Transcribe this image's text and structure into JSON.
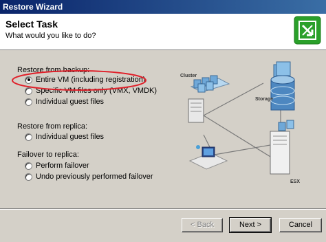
{
  "window": {
    "title": "Restore Wizard"
  },
  "header": {
    "title": "Select Task",
    "subtitle": "What would you like to do?"
  },
  "sections": {
    "backup": {
      "label": "Restore from backup:",
      "options": [
        {
          "label": "Entire VM (including registration)",
          "checked": true
        },
        {
          "label": "Specific VM files only (VMX, VMDK)",
          "checked": false
        },
        {
          "label": "Individual guest files",
          "checked": false
        }
      ]
    },
    "replica": {
      "label": "Restore from replica:",
      "options": [
        {
          "label": "Individual guest files",
          "checked": false
        }
      ]
    },
    "failover": {
      "label": "Failover to replica:",
      "options": [
        {
          "label": "Perform failover",
          "checked": false
        },
        {
          "label": "Undo previously performed failover",
          "checked": false
        }
      ]
    }
  },
  "diagram": {
    "cluster_label": "Cluster",
    "storage_label": "Storage",
    "esx_label": "ESX"
  },
  "buttons": {
    "back": "< Back",
    "next": "Next >",
    "cancel": "Cancel"
  },
  "colors": {
    "highlight_ellipse": "#e0202a",
    "accent_green": "#2aa02a"
  }
}
